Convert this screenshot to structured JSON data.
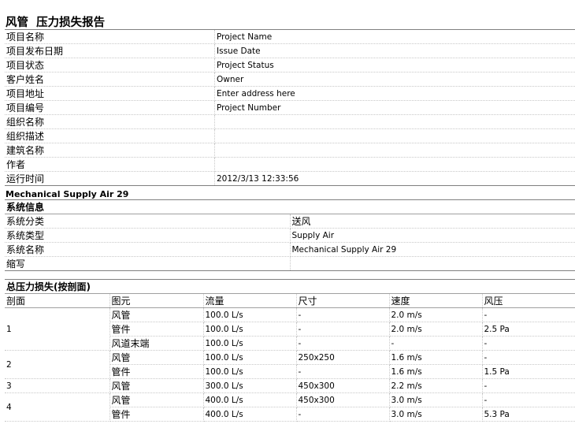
{
  "report_title": "风管  压力损失报告",
  "project_info": [
    {
      "label": "项目名称",
      "value": "Project Name"
    },
    {
      "label": "项目发布日期",
      "value": "Issue Date"
    },
    {
      "label": "项目状态",
      "value": "Project Status"
    },
    {
      "label": "客户姓名",
      "value": "Owner"
    },
    {
      "label": "项目地址",
      "value": "Enter address here"
    },
    {
      "label": "项目编号",
      "value": "Project Number"
    },
    {
      "label": "组织名称",
      "value": ""
    },
    {
      "label": "组织描述",
      "value": ""
    },
    {
      "label": "建筑名称",
      "value": ""
    },
    {
      "label": "作者",
      "value": ""
    },
    {
      "label": "运行时间",
      "value": "2012/3/13 12:33:56"
    }
  ],
  "system_name_heading": "Mechanical Supply Air 29",
  "system_info": {
    "heading": "系统信息",
    "rows": [
      {
        "label": "系统分类",
        "value": "送风"
      },
      {
        "label": "系统类型",
        "value": "Supply Air"
      },
      {
        "label": "系统名称",
        "value": "Mechanical Supply Air 29"
      },
      {
        "label": "缩写",
        "value": ""
      }
    ]
  },
  "pressure_loss": {
    "heading": "总压力损失(按剖面)",
    "columns": [
      "剖面",
      "图元",
      "流量",
      "尺寸",
      "速度",
      "风压"
    ],
    "sections": [
      {
        "section": "1",
        "rows": [
          {
            "element": "风管",
            "flow": "100.0 L/s",
            "size": "-",
            "velocity": "2.0 m/s",
            "pressure": "-"
          },
          {
            "element": "管件",
            "flow": "100.0 L/s",
            "size": "-",
            "velocity": "2.0 m/s",
            "pressure": "2.5 Pa"
          },
          {
            "element": "风道末端",
            "flow": "100.0 L/s",
            "size": "-",
            "velocity": "-",
            "pressure": "-"
          }
        ]
      },
      {
        "section": "2",
        "rows": [
          {
            "element": "风管",
            "flow": "100.0 L/s",
            "size": "250x250",
            "velocity": "1.6 m/s",
            "pressure": "-"
          },
          {
            "element": "管件",
            "flow": "100.0 L/s",
            "size": "-",
            "velocity": "1.6 m/s",
            "pressure": "1.5 Pa"
          }
        ]
      },
      {
        "section": "3",
        "rows": [
          {
            "element": "风管",
            "flow": "300.0 L/s",
            "size": "450x300",
            "velocity": "2.2 m/s",
            "pressure": "-"
          }
        ]
      },
      {
        "section": "4",
        "rows": [
          {
            "element": "风管",
            "flow": "400.0 L/s",
            "size": "450x300",
            "velocity": "3.0 m/s",
            "pressure": "-"
          },
          {
            "element": "管件",
            "flow": "400.0 L/s",
            "size": "-",
            "velocity": "3.0 m/s",
            "pressure": "5.3 Pa"
          }
        ]
      }
    ]
  }
}
